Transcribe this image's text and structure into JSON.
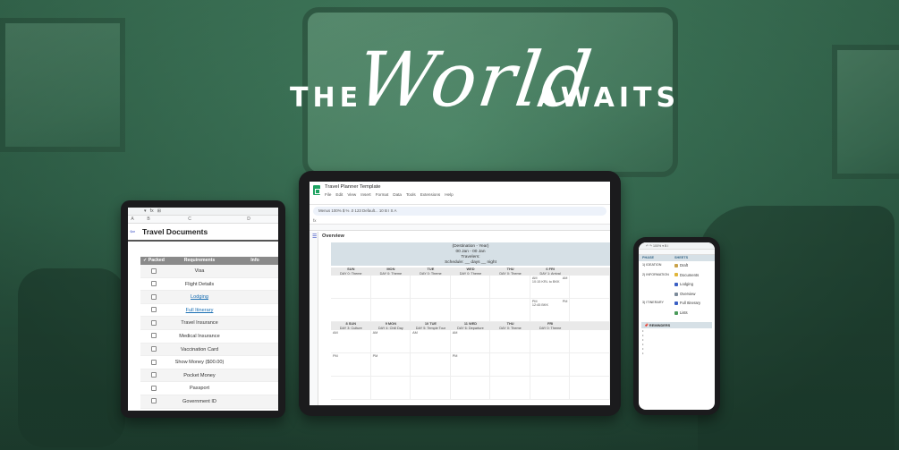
{
  "headline": {
    "the": "THE",
    "world": "World",
    "awaits": "AWAITS"
  },
  "left_tablet": {
    "columns": [
      "A",
      "B",
      "C",
      "D"
    ],
    "title": "Travel Documents",
    "table_headers": [
      "✓ Packed",
      "Requirements",
      "Info"
    ],
    "rows": [
      {
        "label": "Visa",
        "link": false
      },
      {
        "label": "Flight Details",
        "link": false
      },
      {
        "label": "Lodging",
        "link": true
      },
      {
        "label": "Full Itinerary",
        "link": true
      },
      {
        "label": "Travel Insurance",
        "link": false
      },
      {
        "label": "Medical Insurance",
        "link": false
      },
      {
        "label": "Vaccination Card",
        "link": false
      },
      {
        "label": "Show Money ($00.00)",
        "link": false
      },
      {
        "label": "Pocket Money",
        "link": false
      },
      {
        "label": "Passport",
        "link": false
      },
      {
        "label": "Government ID",
        "link": false
      }
    ]
  },
  "center_tablet": {
    "doc_title": "Travel Planner Template",
    "menus": [
      "File",
      "Edit",
      "View",
      "Insert",
      "Format",
      "Data",
      "Tools",
      "Extensions",
      "Help"
    ],
    "toolbar_text": "Menus   100%   $   %   .0   123   Default...   10   B  I  S  A",
    "overview": "Overview",
    "banner": [
      "(Destination - Year)",
      "00 Jan - 00 Jan",
      "Travelers:",
      "Schedule: __ days __ night"
    ],
    "week1": [
      {
        "day": "SUN",
        "sub": "DAY 0: Theme"
      },
      {
        "day": "MON",
        "sub": "DAY 0: Theme"
      },
      {
        "day": "TUE",
        "sub": "DAY 0: Theme"
      },
      {
        "day": "WED",
        "sub": "DAY 0: Theme"
      },
      {
        "day": "THU",
        "sub": "DAY 0: Theme"
      },
      {
        "day": "6 FRI",
        "sub": "DAY 1: Arrival"
      }
    ],
    "arrival": {
      "am": "AM",
      "am_right": "AM",
      "flight": "10:15 KRL to BKK",
      "pm": "PM",
      "pm_right": "PM",
      "time": "12:45 BKK"
    },
    "week2": [
      {
        "day": "8 SUN",
        "sub": "DAY 3: Culture"
      },
      {
        "day": "9 MON",
        "sub": "DAY 4: Chill Day"
      },
      {
        "day": "10 TUE",
        "sub": "DAY 5: Temple Tour"
      },
      {
        "day": "11 WED",
        "sub": "DAY 6: Departure"
      },
      {
        "day": "THU",
        "sub": "DAY 0: Theme"
      },
      {
        "day": "FRI",
        "sub": "DAY 0: Theme"
      }
    ],
    "cell_am": "AM",
    "cell_pm": "PM"
  },
  "phone": {
    "headers": [
      "PHASE",
      "SHEETS"
    ],
    "blocks": [
      {
        "phase": "1) IDEATION",
        "sheets": [
          {
            "label": "Draft",
            "color": "#c9a24a"
          }
        ]
      },
      {
        "phase": "2) INFORMATION",
        "sheets": [
          {
            "label": "Documents",
            "color": "#e0b53a"
          },
          {
            "label": "Lodging",
            "color": "#3a5fc4"
          },
          {
            "label": "Overview",
            "color": "#7b8a99"
          }
        ]
      },
      {
        "phase": "3) ITINERARY",
        "sheets": [
          {
            "label": "Full Itinerary",
            "color": "#3a5fc4"
          },
          {
            "label": "Lists",
            "color": "#4a9a5a"
          }
        ]
      }
    ],
    "reminders": "📌 REMINDERS",
    "bullets": [
      "•",
      "•",
      "•",
      "•",
      "•",
      "•"
    ]
  },
  "colors": {
    "background_green": "#356b51",
    "banner_blue": "#d6e0e6",
    "sheets_green": "#1ea362"
  }
}
